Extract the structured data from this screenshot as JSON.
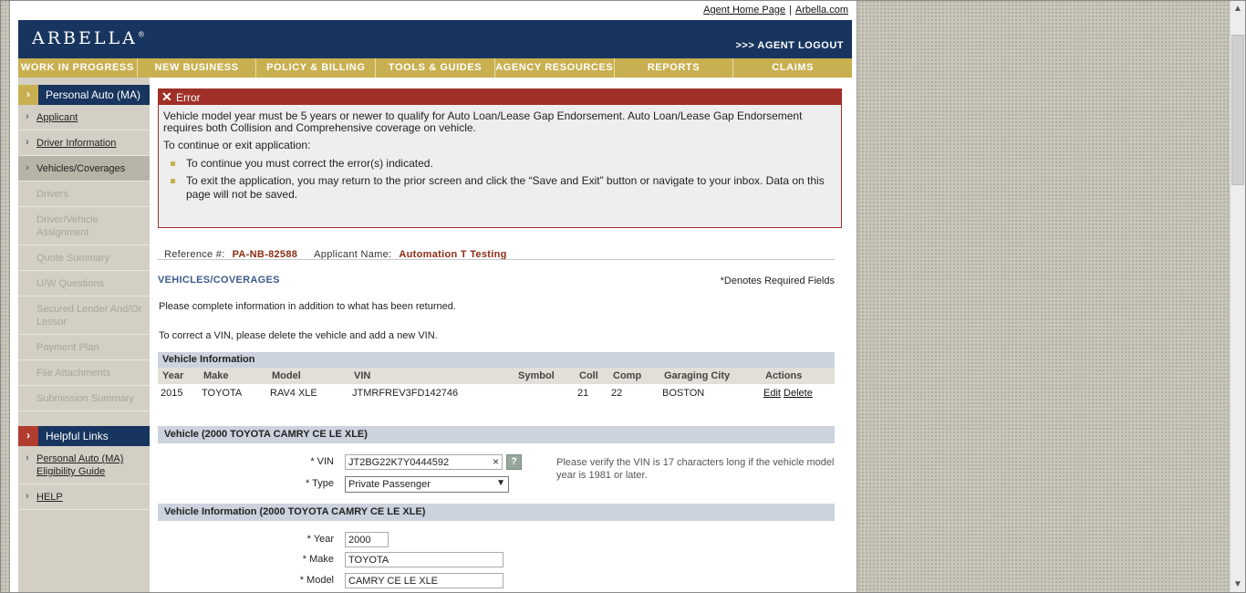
{
  "top_links": {
    "agent_home": "Agent Home Page",
    "separator": "|",
    "arbella_com": "Arbella.com"
  },
  "header": {
    "logo": "ARBELLA",
    "logo_mark": "®",
    "logout": ">>> AGENT LOGOUT"
  },
  "nav": [
    "WORK IN PROGRESS",
    "NEW BUSINESS",
    "POLICY & BILLING",
    "TOOLS & GUIDES",
    "AGENCY RESOURCES",
    "REPORTS",
    "CLAIMS"
  ],
  "sidebar": {
    "title": "Personal Auto (MA)",
    "items": [
      {
        "label": "Applicant",
        "state": "link"
      },
      {
        "label": "Driver Information",
        "state": "link"
      },
      {
        "label": "Vehicles/Coverages",
        "state": "current"
      },
      {
        "label": "Drivers",
        "state": "disabled"
      },
      {
        "label": "Driver/Vehicle Assignment",
        "state": "disabled"
      },
      {
        "label": "Quote Summary",
        "state": "disabled"
      },
      {
        "label": "U/W Questions",
        "state": "disabled"
      },
      {
        "label": "Secured Lender And/Or Lessor",
        "state": "disabled"
      },
      {
        "label": "Payment Plan",
        "state": "disabled"
      },
      {
        "label": "File Attachments",
        "state": "disabled"
      },
      {
        "label": "Submission Summary",
        "state": "disabled"
      }
    ],
    "helpful_title": "Helpful Links",
    "helpful_links": [
      "Personal Auto (MA) Eligibility Guide",
      "HELP"
    ]
  },
  "error": {
    "title": "Error",
    "message": "Vehicle model year must be 5 years or newer to qualify for Auto Loan/Lease Gap Endorsement. Auto Loan/Lease Gap Endorsement requires both Collision and Comprehensive coverage on vehicle.",
    "instruction": "To continue or exit application:",
    "bullets": [
      "To continue you must correct the error(s) indicated.",
      "To exit the application, you may return to the prior screen and click the “Save and Exit” button or navigate to your inbox. Data on this page will not be saved."
    ]
  },
  "reference": {
    "ref_label": "Reference #:",
    "ref_value": "PA-NB-82588",
    "app_label": "Applicant Name:",
    "app_value": "Automation T Testing"
  },
  "section": {
    "title": "VEHICLES/COVERAGES",
    "required_note": "*Denotes Required Fields",
    "para1": "Please complete information in addition to what has been returned.",
    "para2": "To correct a VIN, please delete the vehicle and add a new VIN."
  },
  "vehicle_table": {
    "title": "Vehicle Information",
    "columns": [
      "Year",
      "Make",
      "Model",
      "VIN",
      "Symbol",
      "Coll",
      "Comp",
      "Garaging City",
      "Actions"
    ],
    "rows": [
      {
        "year": "2015",
        "make": "TOYOTA",
        "model": "RAV4 XLE",
        "vin": "JTMRFREV3FD142746",
        "symbol": "",
        "coll": "21",
        "comp": "22",
        "city": "BOSTON",
        "edit": "Edit",
        "delete": "Delete"
      }
    ]
  },
  "vehicle_form": {
    "header": "Vehicle (2000 TOYOTA CAMRY CE LE XLE)",
    "vin_label": "* VIN",
    "vin_value": "JT2BG22K7Y0444592",
    "clear_icon": "×",
    "help_icon": "?",
    "type_label": "* Type",
    "type_value": "Private Passenger",
    "caret": "▼",
    "vin_note": "Please verify the VIN is 17 characters long if the vehicle model year is 1981 or later."
  },
  "vehicle_info_form": {
    "header": "Vehicle Information (2000 TOYOTA CAMRY CE LE XLE)",
    "year_label": "* Year",
    "year_value": "2000",
    "make_label": "* Make",
    "make_value": "TOYOTA",
    "model_label": "* Model",
    "model_value": "CAMRY CE LE XLE"
  },
  "scrollbar": {
    "up": "▲",
    "down": "▼"
  }
}
